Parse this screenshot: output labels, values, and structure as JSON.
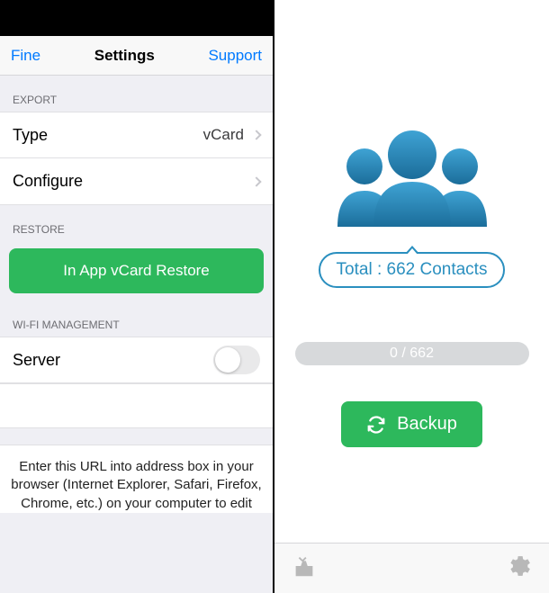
{
  "left": {
    "nav": {
      "left": "Fine",
      "title": "Settings",
      "right": "Support"
    },
    "sections": {
      "export": {
        "header": "EXPORT",
        "type_label": "Type",
        "type_value": "vCard",
        "configure_label": "Configure"
      },
      "restore": {
        "header": "RESTORE",
        "button": "In App vCard Restore"
      },
      "wifi": {
        "header": "WI-FI MANAGEMENT",
        "server_label": "Server",
        "server_on": false
      }
    },
    "footer": "Enter this URL into address box in your browser (Internet Explorer, Safari, Firefox, Chrome, etc.) on your computer to edit"
  },
  "right": {
    "total_label": "Total : 662 Contacts",
    "progress_text": "0 / 662",
    "backup_label": "Backup"
  }
}
